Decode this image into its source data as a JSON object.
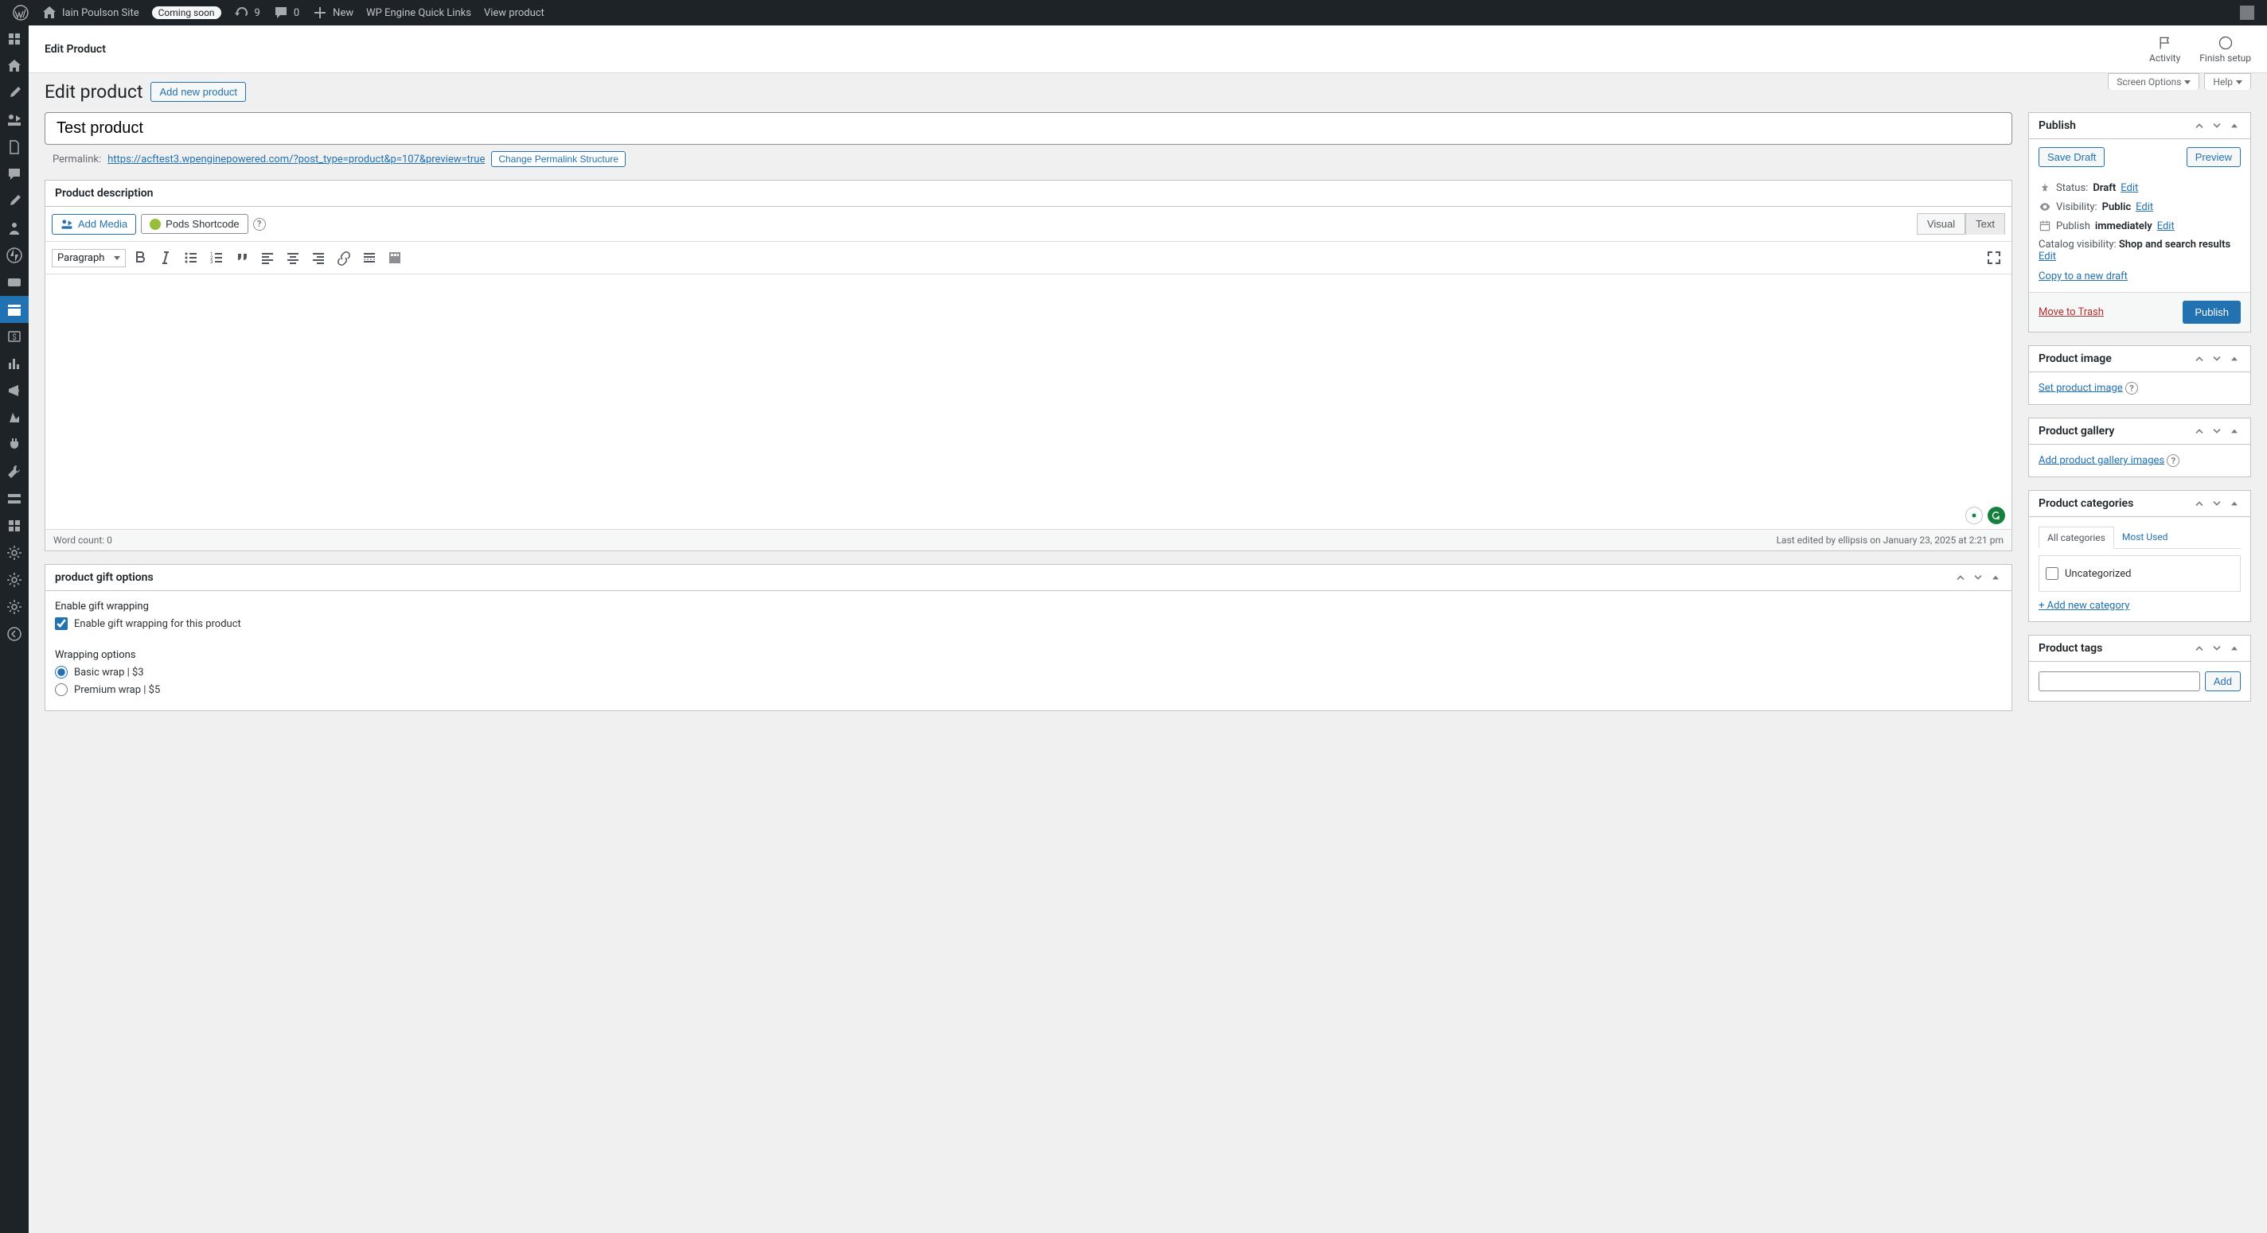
{
  "adminbar": {
    "site_name": "Iain Poulson Site",
    "coming_soon": "Coming soon",
    "refresh_count": "9",
    "comments_count": "0",
    "new_label": "New",
    "wpengine_label": "WP Engine Quick Links",
    "view_product": "View product"
  },
  "topbar": {
    "title": "Edit Product",
    "activity": "Activity",
    "finish": "Finish setup"
  },
  "screen_tabs": {
    "options": "Screen Options",
    "help": "Help"
  },
  "page": {
    "heading": "Edit product",
    "add_new": "Add new product",
    "title_value": "Test product",
    "permalink_label": "Permalink:",
    "permalink_url": "https://acftest3.wpenginepowered.com/?post_type=product&p=107&preview=true",
    "change_permalink": "Change Permalink Structure"
  },
  "editor": {
    "box_title": "Product description",
    "add_media": "Add Media",
    "pods": "Pods Shortcode",
    "visual": "Visual",
    "text": "Text",
    "paragraph": "Paragraph",
    "word_count": "Word count: 0",
    "last_edited": "Last edited by ellipsis on January 23, 2025 at 2:21 pm"
  },
  "gift": {
    "box_title": "product gift options",
    "enable_label": "Enable gift wrapping",
    "enable_check": "Enable gift wrapping for this product",
    "options_label": "Wrapping options",
    "option1": "Basic wrap | $3",
    "option2": "Premium wrap | $5"
  },
  "publish": {
    "title": "Publish",
    "save_draft": "Save Draft",
    "preview": "Preview",
    "status_label": "Status:",
    "status_value": "Draft",
    "visibility_label": "Visibility:",
    "visibility_value": "Public",
    "publish_label": "Publish",
    "publish_value": "immediately",
    "catalog_label": "Catalog visibility:",
    "catalog_value": "Shop and search results",
    "edit": "Edit",
    "copy_draft": "Copy to a new draft",
    "move_trash": "Move to Trash",
    "publish_btn": "Publish"
  },
  "image_box": {
    "title": "Product image",
    "link": "Set product image"
  },
  "gallery_box": {
    "title": "Product gallery",
    "link": "Add product gallery images"
  },
  "categories": {
    "title": "Product categories",
    "tab_all": "All categories",
    "tab_used": "Most Used",
    "uncategorized": "Uncategorized",
    "add_new": "+ Add new category"
  },
  "tags": {
    "title": "Product tags",
    "add": "Add"
  }
}
